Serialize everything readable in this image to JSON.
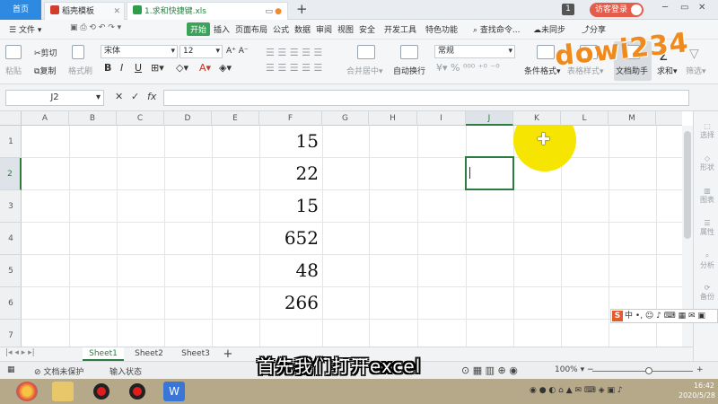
{
  "tabs": {
    "home": "首页",
    "template": "稻壳模板",
    "file": "1.求和快捷键.xls",
    "page_count": "1",
    "login": "访客登录"
  },
  "menu": {
    "file": "文件",
    "items": [
      "开始",
      "插入",
      "页面布局",
      "公式",
      "数据",
      "审阅",
      "视图",
      "安全",
      "开发工具",
      "特色功能"
    ],
    "search": "查找命令...",
    "sync": "未同步",
    "share": "分享"
  },
  "ribbon": {
    "paste": "粘贴",
    "cut": "剪切",
    "copy": "复制",
    "format_painter": "格式刷",
    "font_name": "宋体",
    "font_size": "12",
    "merge_center": "合并居中",
    "wrap": "自动换行",
    "number_format": "常规",
    "cond_format": "条件格式",
    "table_style": "表格样式",
    "doc_helper": "文档助手",
    "sum": "求和",
    "filter": "筛选"
  },
  "formula_bar": {
    "cell_ref": "J2",
    "fx": "fx",
    "value": ""
  },
  "grid": {
    "columns": [
      "A",
      "B",
      "C",
      "D",
      "E",
      "F",
      "G",
      "H",
      "I",
      "J",
      "K",
      "L",
      "M"
    ],
    "rows": [
      "1",
      "2",
      "3",
      "4",
      "5",
      "6",
      "7"
    ],
    "selected_col": "J",
    "selected_row": "2",
    "values_col_F": [
      "15",
      "22",
      "15",
      "652",
      "48",
      "266"
    ]
  },
  "right_panel": [
    "选择",
    "形状",
    "图表",
    "属性",
    "分析",
    "备份"
  ],
  "ime": "中",
  "sheets": [
    "Sheet1",
    "Sheet2",
    "Sheet3"
  ],
  "status": {
    "protect": "文档未保护",
    "mode": "输入状态",
    "zoom": "100%"
  },
  "subtitle": "首先我们打开excel",
  "watermark": "dowi234",
  "clock": {
    "time": "16:42",
    "date": "2020/5/28"
  },
  "colors": {
    "accent_green": "#2b7c3e",
    "home_tab": "#2d8ae0",
    "highlight": "#f5e500"
  }
}
